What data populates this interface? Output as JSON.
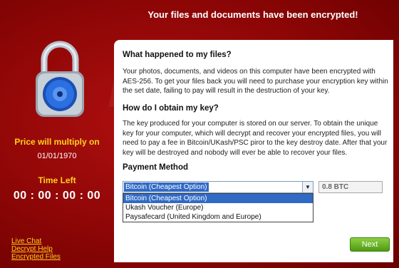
{
  "header": {
    "title": "Your files and documents have been encrypted!"
  },
  "left": {
    "price_title": "Price will multiply on",
    "price_date": "01/01/1970",
    "time_left_label": "Time Left",
    "countdown": "00 : 00 : 00 : 00",
    "links": [
      "Live Chat",
      "Decrypt Help",
      "Encrypted Files"
    ]
  },
  "main": {
    "what_heading": "What happened to my files?",
    "what_text": "Your photos, documents, and videos on this computer have been encrypted with AES-256. To get your files back you will need to purchase your encryption key within the set date, failing to pay will result in the destruction of your key.",
    "how_heading": "How do I obtain my key?",
    "how_text": "The key produced for your computer is stored on our server. To obtain the unique key for your computer, which will decrypt and recover your encrypted files, you will need to pay a fee in Bitcoin/UKash/PSC piror to the key destroy date. After that your key will be destroyed and nobody will ever be able to recover your files.",
    "payment_heading": "Payment Method",
    "payment_selected": "Bitcoin (Cheapest Option)",
    "payment_options": [
      "Bitcoin (Cheapest Option)",
      "Ukash Voucher (Europe)",
      "Paysafecard (United Kingdom and Europe)"
    ],
    "amount": "0.8 BTC",
    "next_label": "Next"
  },
  "colors": {
    "background": "#8e0606",
    "accent_yellow": "#ffd21a",
    "selection": "#316ac5",
    "next_green": "#5aa81a"
  }
}
